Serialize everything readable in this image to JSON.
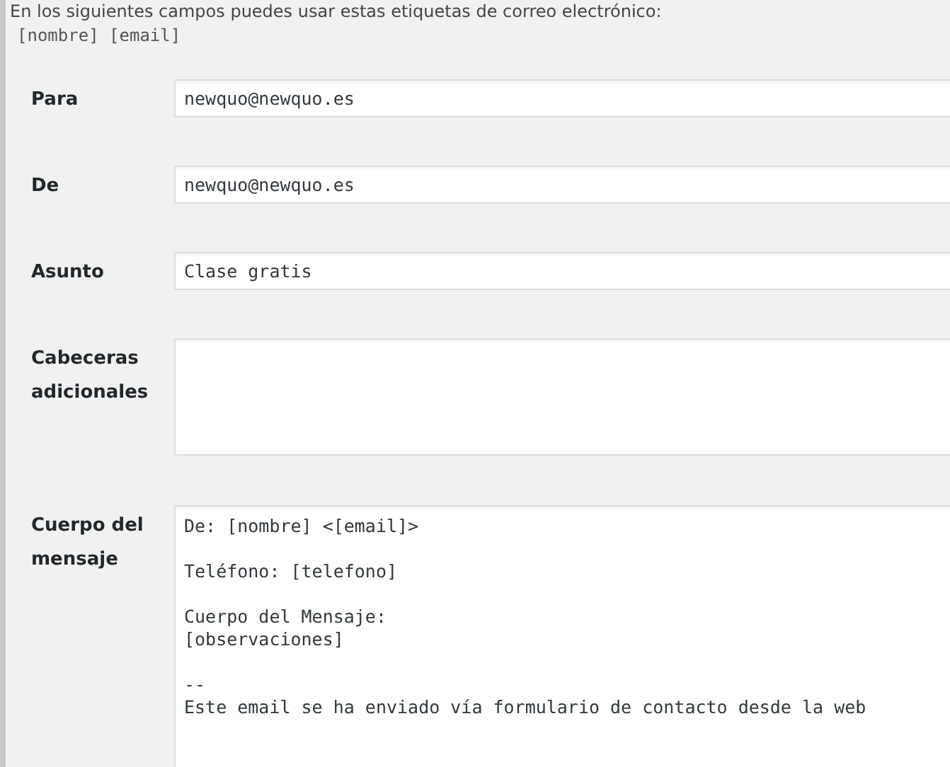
{
  "intro": {
    "text": "En los siguientes campos puedes usar estas etiquetas de correo electrónico:",
    "tags": "[nombre] [email]"
  },
  "fields": [
    {
      "label": "Para",
      "kind": "input",
      "value": "newquo@newquo.es"
    },
    {
      "label": "De",
      "kind": "input",
      "value": "newquo@newquo.es"
    },
    {
      "label": "Asunto",
      "kind": "input",
      "value": "Clase gratis"
    },
    {
      "label": "Cabeceras adicionales",
      "kind": "textarea"
    },
    {
      "label": "Cuerpo del mensaje",
      "kind": "body",
      "value": "De: [nombre] <[email]>\n\nTeléfono: [telefono]\n\nCuerpo del Mensaje:\n[observaciones]\n\n--\nEste email se ha enviado vía formulario de contacto desde la web"
    }
  ]
}
